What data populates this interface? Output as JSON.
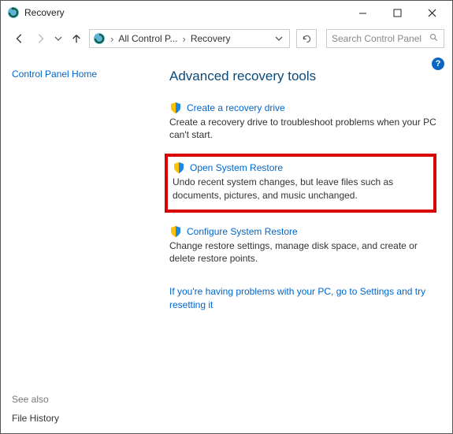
{
  "window": {
    "title": "Recovery",
    "min_tooltip": "Minimize",
    "max_tooltip": "Maximize",
    "close_tooltip": "Close"
  },
  "nav": {
    "back_tooltip": "Back",
    "forward_tooltip": "Forward",
    "recent_tooltip": "Recent locations",
    "up_tooltip": "Up",
    "refresh_tooltip": "Refresh"
  },
  "breadcrumb": {
    "crumb1": "All Control P...",
    "crumb2": "Recovery"
  },
  "search": {
    "placeholder": "Search Control Panel"
  },
  "sidebar": {
    "home": "Control Panel Home",
    "seealso_label": "See also",
    "seealso_link": "File History"
  },
  "main": {
    "heading": "Advanced recovery tools",
    "item1": {
      "link": "Create a recovery drive",
      "desc": "Create a recovery drive to troubleshoot problems when your PC can't start."
    },
    "item2": {
      "link": "Open System Restore",
      "desc": "Undo recent system changes, but leave files such as documents, pictures, and music unchanged."
    },
    "item3": {
      "link": "Configure System Restore",
      "desc": "Change restore settings, manage disk space, and create or delete restore points."
    },
    "footer_link": "If you're having problems with your PC, go to Settings and try resetting it"
  },
  "help_badge": "?"
}
